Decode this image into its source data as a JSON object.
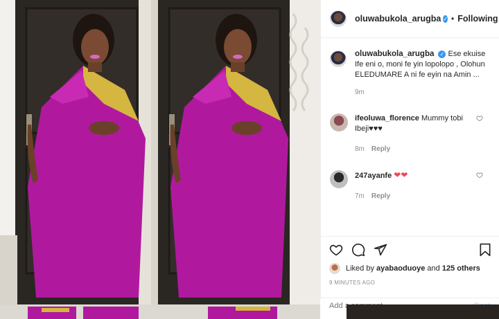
{
  "post": {
    "author": "oluwabukola_arugba",
    "verified_mark": "✓",
    "separator": "•",
    "follow_label": "Following"
  },
  "caption": {
    "user": "oluwabukola_arugba",
    "text": "Ese ekuise Ife eni o, moni fe yin lopolopo , Olohun ELEDUMARE A ni fe eyin na Amin ...",
    "time": "9m"
  },
  "comments": [
    {
      "user": "ifeoluwa_florence",
      "text": "Mummy tobi Ibeji♥♥♥",
      "time": "8m",
      "reply": "Reply"
    },
    {
      "user": "247ayanfe",
      "text": "❤❤",
      "time": "7m",
      "reply": "Reply"
    }
  ],
  "likes": {
    "prefix": "Liked by",
    "user": "ayabaoduoye",
    "middle": "and",
    "count": "125 others"
  },
  "timestamp": "9 MINUTES AGO",
  "add_comment": {
    "placeholder": "Add a comment...",
    "post_label": "Post"
  },
  "colors": {
    "dress": "#b0199e",
    "embroidery": "#d4b640",
    "door": "#2a2622",
    "wall": "#e8e4de",
    "accent": "#3897f0",
    "heart": "#ed4956"
  },
  "icons": [
    "heart-icon",
    "comment-icon",
    "share-icon",
    "bookmark-icon",
    "verified-icon",
    "like-heart-icon"
  ]
}
